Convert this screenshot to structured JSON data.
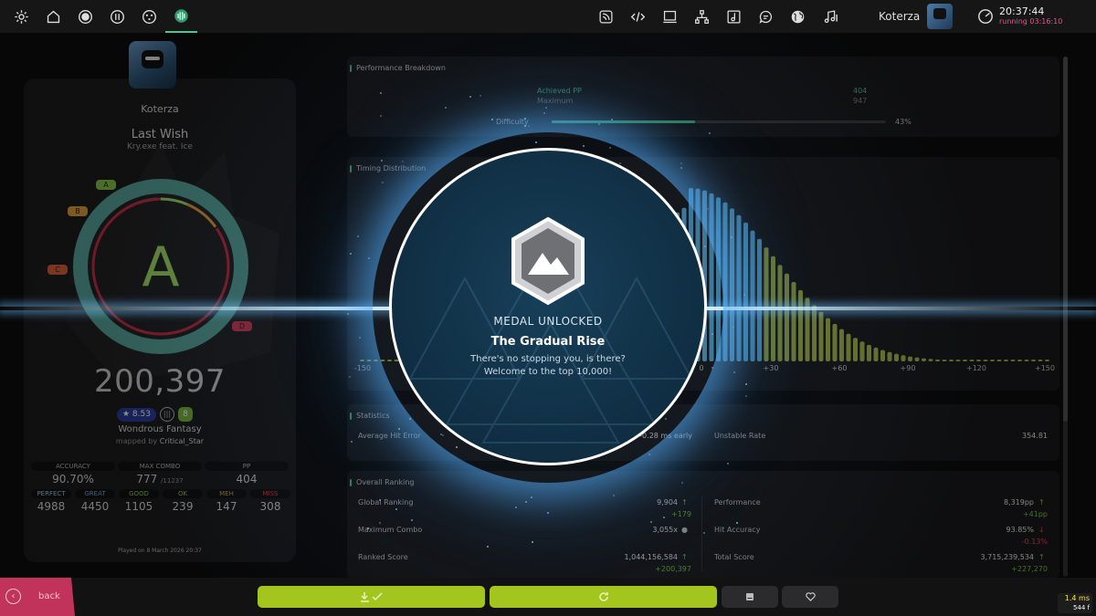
{
  "toolbar": {
    "left_icons": [
      "settings-icon",
      "home-icon",
      "circle-icon",
      "info-icon",
      "dice-icon",
      "results-icon"
    ],
    "right_icons": [
      "news-icon",
      "code-icon",
      "tablet-icon",
      "tree-icon",
      "music-note-box-icon",
      "chat-icon",
      "globe-icon",
      "music-icon"
    ],
    "username": "Koterza",
    "time": "20:37:44",
    "running": "running 03:16:10"
  },
  "player": {
    "name": "Koterza"
  },
  "beatmap": {
    "title": "Last Wish",
    "artist": "Kry.exe feat. Ice",
    "difficulty_name": "Wondrous Fantasy",
    "mapper_prefix": "mapped by",
    "mapper": "Critical_Star",
    "star_rating": "★ 8.53"
  },
  "result": {
    "rank": "A",
    "rank_fill_fraction": 0.907,
    "grades": [
      "A",
      "B",
      "C",
      "D"
    ],
    "score": "200,397",
    "stats": [
      {
        "label": "ACCURACY",
        "value": "90.70%"
      },
      {
        "label": "MAX COMBO",
        "value": "777",
        "sub": "/11237"
      },
      {
        "label": "PP",
        "value": "404"
      }
    ],
    "judgements": [
      {
        "label": "PERFECT",
        "value": "4988",
        "color": "#9cd0f5"
      },
      {
        "label": "GREAT",
        "value": "4450",
        "color": "#6ab0f0"
      },
      {
        "label": "GOOD",
        "value": "1105",
        "color": "#8bd34a"
      },
      {
        "label": "OK",
        "value": "239",
        "color": "#a6cc2d"
      },
      {
        "label": "MEH",
        "value": "147",
        "color": "#e0a23c"
      },
      {
        "label": "MISS",
        "value": "308",
        "color": "#e0445a"
      }
    ],
    "played_on": "Played on 8 March 2026 20:37"
  },
  "performance_breakdown": {
    "title": "Performance Breakdown",
    "achieved_label": "Achieved PP",
    "achieved_value": "404",
    "maximum_label": "Maximum",
    "maximum_value": "947",
    "difficulty_label": "Difficulty",
    "difficulty_percent": "43%",
    "difficulty_fraction": 0.43
  },
  "timing": {
    "title": "Timing Distribution",
    "ticks": [
      "-150",
      "0",
      "+30",
      "+60",
      "+90",
      "+120",
      "+150"
    ]
  },
  "statistics": {
    "title": "Statistics",
    "avg_hit_error_label": "Average Hit Error",
    "avg_hit_error_value": "-0.28 ms early",
    "unstable_rate_label": "Unstable Rate",
    "unstable_rate_value": "354.81"
  },
  "overall_ranking": {
    "title": "Overall Ranking",
    "rows": [
      {
        "label": "Global Ranking",
        "value": "9,904",
        "delta": "+179",
        "dir": "up"
      },
      {
        "label": "Maximum Combo",
        "value": "3,055x",
        "delta": "",
        "dir": "none"
      },
      {
        "label": "Ranked Score",
        "value": "1,044,156,584",
        "delta": "+200,397",
        "dir": "up"
      },
      {
        "label": "Performance",
        "value": "8,319pp",
        "delta": "+41pp",
        "dir": "up"
      },
      {
        "label": "Hit Accuracy",
        "value": "93.85%",
        "delta": "-0.13%",
        "dir": "down"
      },
      {
        "label": "Total Score",
        "value": "3,715,239,534",
        "delta": "+227,270",
        "dir": "up"
      }
    ]
  },
  "medal": {
    "heading": "MEDAL UNLOCKED",
    "name": "The Gradual Rise",
    "desc_line1": "There's no stopping you, is there?",
    "desc_line2": "Welcome to the top 10,000!"
  },
  "bottom": {
    "back_label": "back",
    "fps_ms": "1.4 ms",
    "fps_frames": "544 f"
  },
  "colors": {
    "accent": "#4ac88c",
    "rank_a": "#a5e36a",
    "back": "#c2335b",
    "button_green": "#a4c51d"
  }
}
